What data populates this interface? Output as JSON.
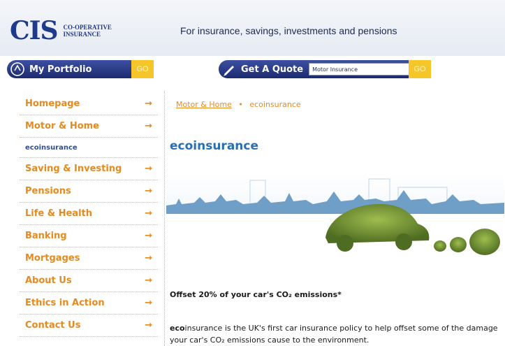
{
  "header": {
    "logo_text": "CIS",
    "logo_sub_line1": "CO-OPERATIVE",
    "logo_sub_line2": "INSURANCE",
    "tagline": "For insurance, savings, investments and pensions"
  },
  "nav": {
    "portfolio_label": "My Portfolio",
    "portfolio_go": "GO",
    "quote_label": "Get A Quote",
    "quote_selected": "Motor Insurance",
    "quote_go": "GO"
  },
  "sidebar": {
    "items": [
      {
        "label": "Homepage",
        "arrow": "→"
      },
      {
        "label": "Motor & Home",
        "arrow": "→"
      },
      {
        "label": "ecoinsurance",
        "arrow": ""
      },
      {
        "label": "Saving & Investing",
        "arrow": "→"
      },
      {
        "label": "Pensions",
        "arrow": "→"
      },
      {
        "label": "Life & Health",
        "arrow": "→"
      },
      {
        "label": "Banking",
        "arrow": "→"
      },
      {
        "label": "Mortgages",
        "arrow": "→"
      },
      {
        "label": "About Us",
        "arrow": "→"
      },
      {
        "label": "Ethics in Action",
        "arrow": "→"
      },
      {
        "label": "Contact Us",
        "arrow": "→"
      }
    ]
  },
  "main": {
    "breadcrumb": {
      "parent": "Motor & Home",
      "separator": "•",
      "current": "ecoinsurance"
    },
    "title": "ecoinsurance",
    "offset_heading": "Offset 20% of your car's CO₂ emissions*",
    "intro_bold": "eco",
    "intro_text": "insurance is the UK's first car insurance policy to help offset some of the damage your car's CO₂ emissions cause to the environment."
  },
  "colors": {
    "brand_blue": "#1e3a8a",
    "accent_orange": "#e68a1e",
    "go_yellow": "#f6c52a",
    "title_blue": "#2a6fb5"
  }
}
